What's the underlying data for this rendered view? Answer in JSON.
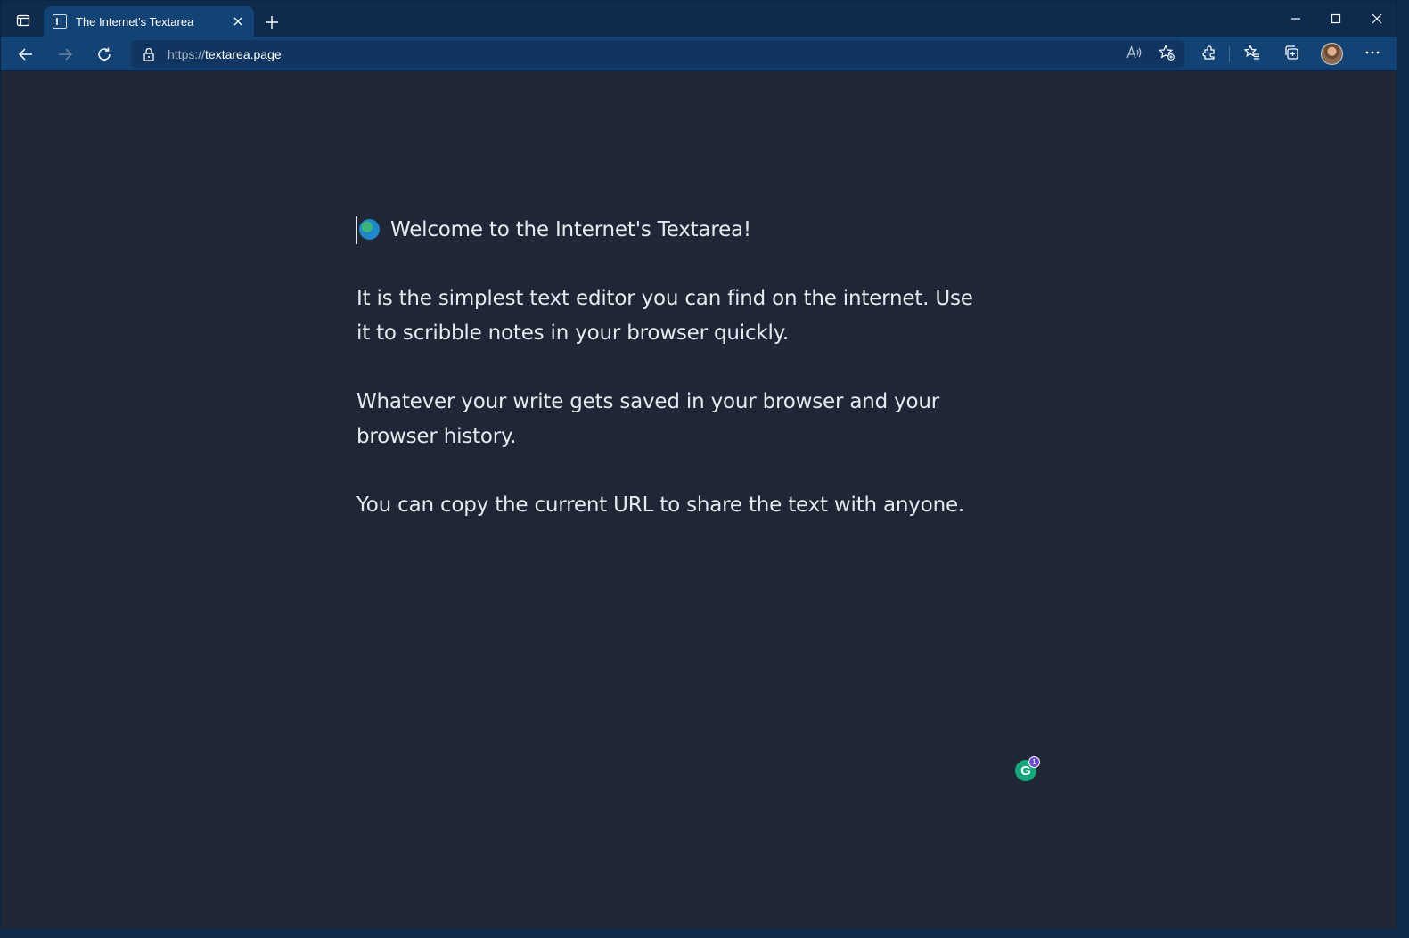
{
  "browser": {
    "tab": {
      "title": "The Internet's Textarea"
    },
    "address_bar": {
      "protocol": "https://",
      "host": "textarea.page"
    },
    "icons": {
      "tab_actions": "tab-actions-icon",
      "new_tab": "plus-icon",
      "minimize": "minimize-icon",
      "maximize": "maximize-icon",
      "close": "close-icon",
      "back": "back-arrow-icon",
      "forward": "forward-arrow-icon",
      "refresh": "refresh-icon",
      "lock": "lock-icon",
      "read_aloud": "read-aloud-icon",
      "add_favorite": "add-favorite-icon",
      "extensions": "extensions-icon",
      "favorites": "favorites-icon",
      "collections": "collections-icon",
      "more": "more-icon"
    }
  },
  "page": {
    "editor": {
      "welcome_line": "Welcome to the Internet's Textarea!",
      "paragraph_1": "It is the simplest text editor you can find on the internet. Use it to scribble notes in your browser quickly.",
      "paragraph_2": "Whatever your write gets saved in your browser and your browser history.",
      "paragraph_3": "You can copy the current URL to share the text with anyone."
    },
    "grammarly": {
      "letter": "G",
      "badge_count": "1",
      "color": "#16a77a",
      "badge_color": "#6c4bd1"
    }
  },
  "colors": {
    "page_background": "#1f2736",
    "text": "#e6e9ee",
    "browser_chrome": "#134274",
    "tabstrip": "#0e2a4d"
  }
}
